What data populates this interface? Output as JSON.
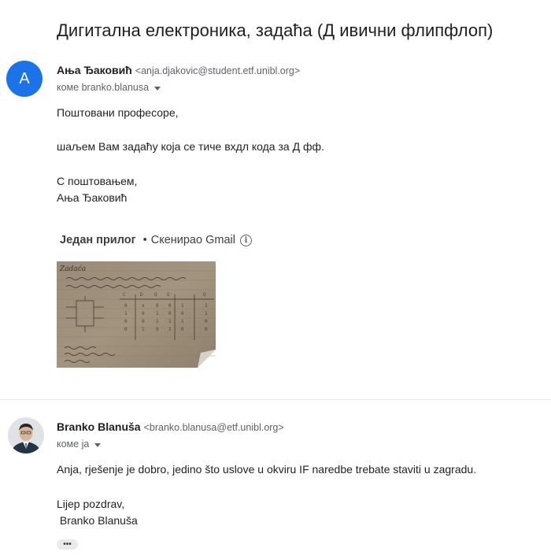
{
  "subject": "Дигитална електроника, задаћа (Д ивични флипфлоп)",
  "messages": [
    {
      "avatar_letter": "A",
      "avatar_color": "#1a73e8",
      "sender_name": "Ања Ђаковић",
      "sender_email": "<anja.djakovic@student.etf.unibl.org>",
      "to": "коме branko.blanusa",
      "greeting": "Поштовани професоре,",
      "line1": "шаљем Вам задаћу која се тиче вхдл кода за Д фф.",
      "closing": "С поштовањем,",
      "signature": "Ања Ђаковић",
      "attachment": {
        "title": "Један прилог",
        "dot": "•",
        "scanned": "Скенирао Gmail",
        "info_icon": "info-icon",
        "handwritten": "Zadaća",
        "name": "attachment-thumbnail"
      }
    },
    {
      "sender_name": "Branko Blanuša",
      "sender_email": "<branko.blanusa@etf.unibl.org>",
      "to": "коме ја",
      "line1": "Anja, rješenje je dobro, jedino što uslove u okviru IF naredbe trebate staviti u zagradu.",
      "closing": "Lijep pozdrav,",
      "signature": " Branko Blanuša",
      "more_label": "•••"
    }
  ]
}
